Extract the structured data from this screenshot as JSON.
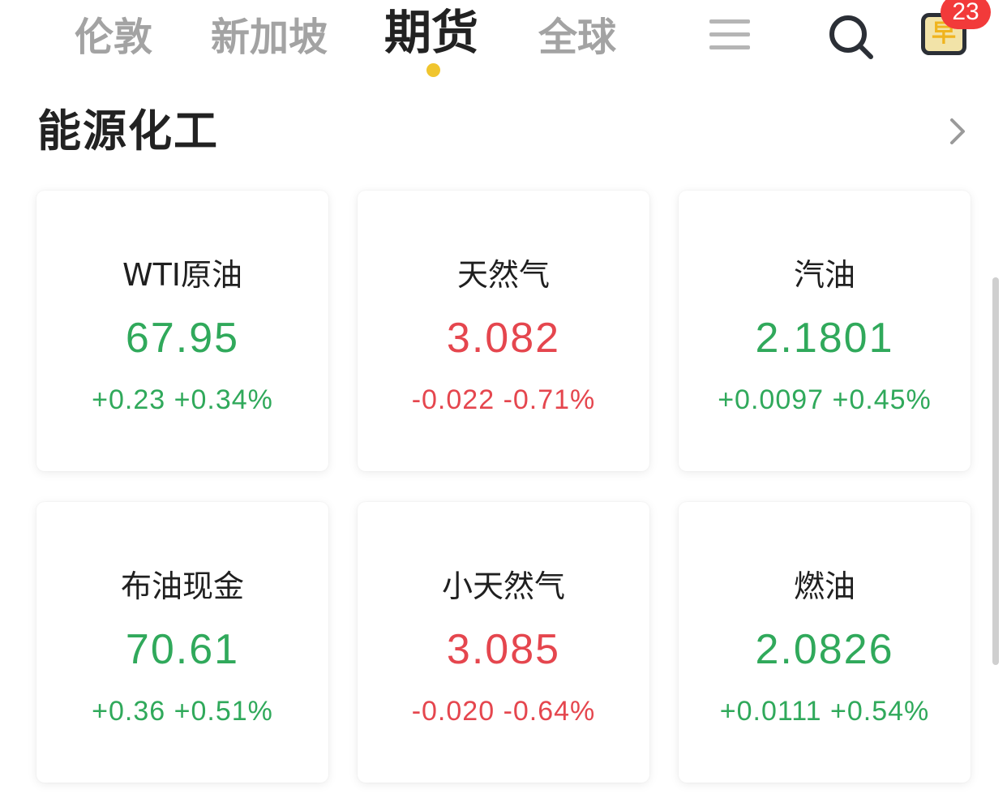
{
  "tabs": [
    {
      "label": "伦敦",
      "active": false
    },
    {
      "label": "新加坡",
      "active": false
    },
    {
      "label": "期货",
      "active": true
    },
    {
      "label": "全球",
      "active": false
    }
  ],
  "header_icons": {
    "menu": "menu-icon",
    "search": "search-icon",
    "app": "app-shortcut-icon",
    "app_glyph": "早",
    "badge_count": "23"
  },
  "section": {
    "title": "能源化工"
  },
  "colors": {
    "up": "#30a95b",
    "down": "#e5464e",
    "active_dot": "#f0c52e",
    "badge": "#f23a3a"
  },
  "cards": [
    {
      "name": "WTI原油",
      "price": "67.95",
      "change": "+0.23",
      "change_pct": "+0.34%",
      "direction": "up"
    },
    {
      "name": "天然气",
      "price": "3.082",
      "change": "-0.022",
      "change_pct": "-0.71%",
      "direction": "down"
    },
    {
      "name": "汽油",
      "price": "2.1801",
      "change": "+0.0097",
      "change_pct": "+0.45%",
      "direction": "up"
    },
    {
      "name": "布油现金",
      "price": "70.61",
      "change": "+0.36",
      "change_pct": "+0.51%",
      "direction": "up"
    },
    {
      "name": "小天然气",
      "price": "3.085",
      "change": "-0.020",
      "change_pct": "-0.64%",
      "direction": "down"
    },
    {
      "name": "燃油",
      "price": "2.0826",
      "change": "+0.0111",
      "change_pct": "+0.54%",
      "direction": "up"
    }
  ]
}
